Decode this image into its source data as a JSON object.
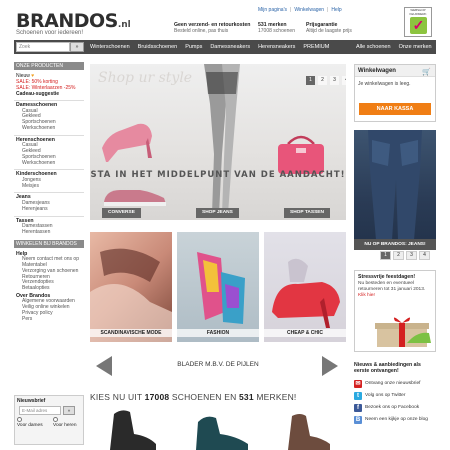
{
  "header": {
    "logo": "BRANDOS",
    "logo_suffix": ".nl",
    "tagline": "Schoenen voor iedereen!",
    "top_links": [
      "Mijn pagina's",
      "Winkelwagen",
      "Help"
    ],
    "usps": [
      {
        "title": "Geen verzend- en retourkosten",
        "sub": "Besteld online, pas thuis"
      },
      {
        "title": "531 merken",
        "sub": "17008 schoenen"
      },
      {
        "title": "Prijsgarantie",
        "sub": "Altijd de laagste prijs"
      }
    ],
    "badge_text": "WEBSHOP KEURMERK"
  },
  "nav": {
    "search_placeholder": "Zoek",
    "search_button": "»",
    "items": [
      "Winterschoenen",
      "Bruidsschoenen",
      "Pumps",
      "Damessneakers",
      "Herensneakers",
      "PREMIUM"
    ],
    "right_items": [
      "Alle schoenen",
      "Onze merken"
    ]
  },
  "sidebar": {
    "header": "ONZE PRODUCTEN",
    "highlights": [
      {
        "label": "Nieuw",
        "style": "normal"
      },
      {
        "label": "SALE: 50% korting",
        "style": "red"
      },
      {
        "label": "SALE: Winterlaarzen -25%",
        "style": "red"
      },
      {
        "label": "Cadeau-suggestie",
        "style": "normal"
      }
    ],
    "categories": [
      {
        "title": "Damesschoenen",
        "items": [
          "Casual",
          "Gekleed",
          "Sportschoenen",
          "Werkschoenen"
        ]
      },
      {
        "title": "Herenschoenen",
        "items": [
          "Casual",
          "Gekleed",
          "Sportschoenen",
          "Werkschoenen"
        ]
      },
      {
        "title": "Kinderschoenen",
        "items": [
          "Jongens",
          "Meisjes"
        ]
      },
      {
        "title": "Jeans",
        "items": [
          "Damesjeans",
          "Herenjeans"
        ]
      },
      {
        "title": "Tassen",
        "items": [
          "Damestassen",
          "Herentassen"
        ]
      }
    ],
    "header2": "WINKELEN BIJ BRANDOS",
    "help": {
      "title": "Help",
      "items": [
        "Neem contact met ons op",
        "Matentabel",
        "Verzorging van schoenen",
        "Retourneren",
        "Verzendopties",
        "Betaalopties"
      ]
    },
    "over": {
      "title": "Over Brandos",
      "items": [
        "Algemene voorwaarden",
        "Veilig online winkelen",
        "Privacy policy",
        "Pers"
      ]
    }
  },
  "newsletter": {
    "title": "Nieuwsbrief",
    "placeholder": "E-Mail adres",
    "button": "»",
    "option1": "Voor dames",
    "option2": "Voor heren"
  },
  "hero": {
    "script_text": "Shop ur style",
    "heading": "STA IN HET MIDDELPUNT VAN DE AANDACHT!",
    "pages": [
      "1",
      "2",
      "3",
      "4"
    ],
    "active_page": "1",
    "pills": [
      "CONVERSE",
      "SHOP JEANS",
      "SHOP TASSEN"
    ]
  },
  "tiles": [
    {
      "caption": "SCANDINAVISCHE MODE"
    },
    {
      "caption": "FASHION"
    },
    {
      "caption": "CHEAP & CHIC"
    }
  ],
  "brands": {
    "text": "BLADER M.B.V. DE PIJLEN",
    "count_prefix": "KIES NU UIT",
    "shoe_count": "17008",
    "count_mid": "SCHOENEN EN",
    "brand_count": "531",
    "count_suffix": "MERKEN!"
  },
  "cart": {
    "title": "Winkelwagen",
    "empty": "Je winkelwagen is leeg.",
    "button": "NAAR KASSA"
  },
  "jeans": {
    "caption": "NU OP BRANDOS: JEANS!",
    "pages": [
      "1",
      "2",
      "3",
      "4"
    ],
    "active_page": "1"
  },
  "promo": {
    "title": "Stressvrije feestdagen!",
    "body": "Nu besteden en eventueel retourneren tot 31 januari 2013.",
    "link": "Klik hier"
  },
  "social": {
    "title": "Nieuws & aanbiedingen als eerste ontvangen!",
    "rows": [
      {
        "icon": "newsletter-icon",
        "color": "#d42020",
        "glyph": "✉",
        "label": "Ontvang onze nieuwsbrief"
      },
      {
        "icon": "twitter-icon",
        "color": "#2aa9e0",
        "glyph": "t",
        "label": "Volg ons op Twitter"
      },
      {
        "icon": "facebook-icon",
        "color": "#3b5998",
        "glyph": "f",
        "label": "Bezoek ons op Facebook"
      },
      {
        "icon": "blog-icon",
        "color": "#5a8fd6",
        "glyph": "B",
        "label": "Neem een kijkje op onze blog"
      }
    ]
  }
}
